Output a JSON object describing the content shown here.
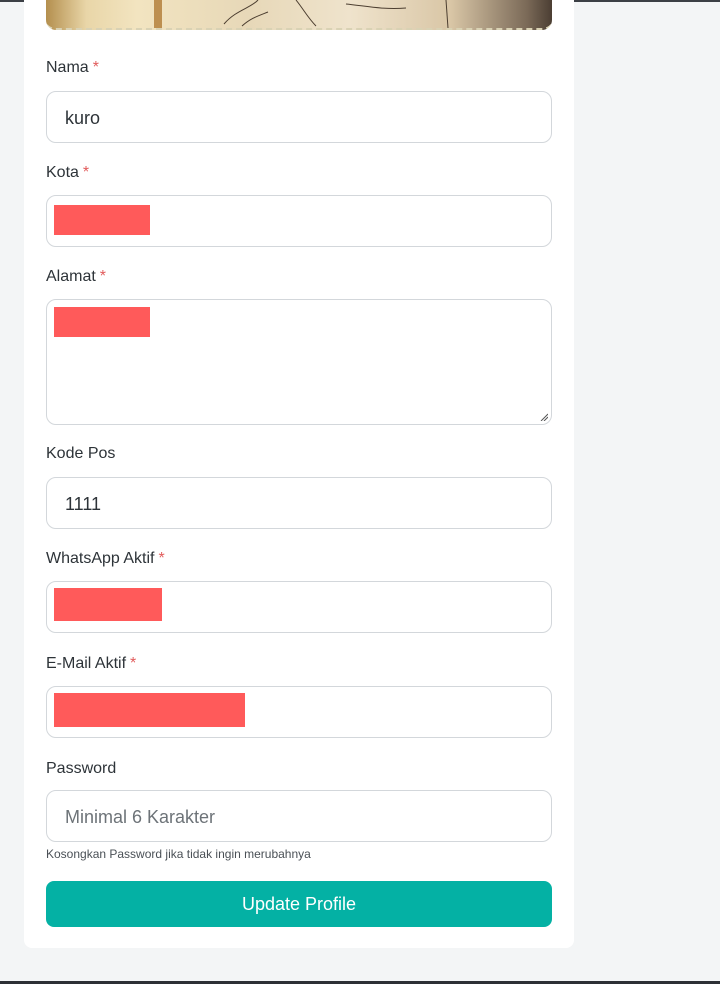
{
  "form": {
    "nama": {
      "label": "Nama",
      "required_mark": "*",
      "value": "kuro"
    },
    "kota": {
      "label": "Kota",
      "required_mark": "*",
      "value": ""
    },
    "alamat": {
      "label": "Alamat",
      "required_mark": "*",
      "value": ""
    },
    "kode_pos": {
      "label": "Kode Pos",
      "value": "1111"
    },
    "whatsapp": {
      "label": "WhatsApp Aktif",
      "required_mark": "*",
      "value": ""
    },
    "email": {
      "label": "E-Mail Aktif",
      "required_mark": "*",
      "value": ""
    },
    "password": {
      "label": "Password",
      "placeholder": "Minimal 6 Karakter",
      "help": "Kosongkan Password jika tidak ingin merubahnya"
    },
    "submit_label": "Update Profile"
  },
  "colors": {
    "accent": "#04b1a4",
    "required": "#e15b5b",
    "redaction": "#ff5a5a",
    "border": "#d3d7db"
  }
}
